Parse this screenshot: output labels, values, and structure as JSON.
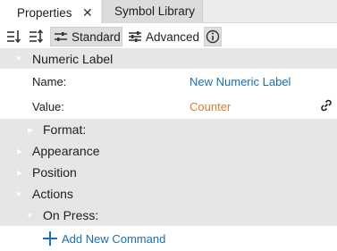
{
  "tabs": [
    {
      "label": "Properties",
      "active": true,
      "closable": true
    },
    {
      "label": "Symbol Library",
      "active": false
    }
  ],
  "toolbar": {
    "sort_asc_icon": "sort-list-icon",
    "sort_desc_icon": "sort-order-icon",
    "standard_label": "Standard",
    "advanced_label": "Advanced",
    "info_icon": "info-icon",
    "close_glyph": "✕"
  },
  "tree": {
    "numeric_label": {
      "label": "Numeric Label",
      "expanded": true
    },
    "name": {
      "label": "Name:",
      "value": "New Numeric Label"
    },
    "value": {
      "label": "Value:",
      "value": "Counter",
      "link_icon": "link-icon"
    },
    "format": {
      "label": "Format:",
      "expanded": false
    },
    "appearance": {
      "label": "Appearance",
      "expanded": false
    },
    "position": {
      "label": "Position",
      "expanded": false
    },
    "actions": {
      "label": "Actions",
      "expanded": true
    },
    "on_press": {
      "label": "On Press:",
      "expanded": true
    },
    "add_command": {
      "label": "Add New Command"
    }
  },
  "colors": {
    "link_blue": "#1a6fb0",
    "value_orange": "#e07b28",
    "group_bg": "#e6e6e6"
  }
}
